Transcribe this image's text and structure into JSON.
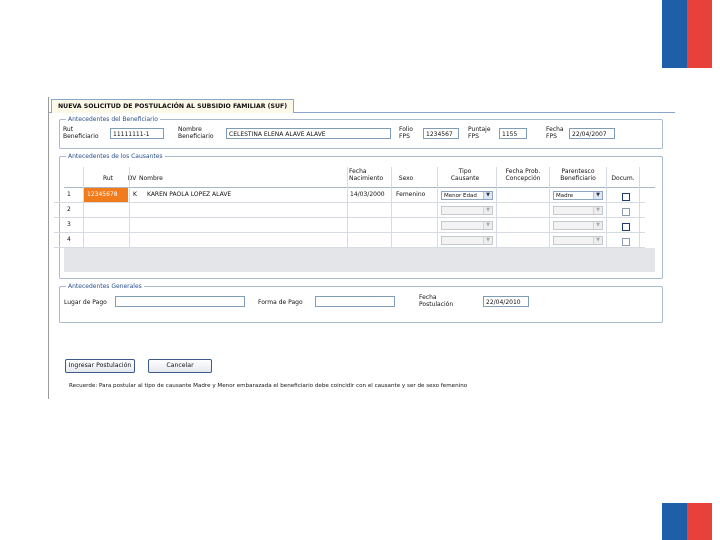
{
  "colors": {
    "flag_blue": "#1f5fa8",
    "flag_red": "#e8413c",
    "rut_highlight": "#f27b1c",
    "fieldset_border": "#a9bccf"
  },
  "tab": {
    "title": "NUEVA SOLICITUD DE POSTULACIÓN AL SUBSIDIO FAMILIAR (SUF)"
  },
  "beneficiario": {
    "legend": "Antecedentes del Beneficiario",
    "rut_label": "Rut Beneficiario",
    "rut_value": "11111111-1",
    "nombre_label": "Nombre Beneficiario",
    "nombre_value": "CELESTINA ELENA ALAVE ALAVE",
    "folio_label": "Folio FPS",
    "folio_value": "1234567",
    "puntaje_label": "Puntaje FPS",
    "puntaje_value": "1155",
    "fecha_label": "Fecha FPS",
    "fecha_value": "22/04/2007"
  },
  "causantes": {
    "legend": "Antecedentes de los Causantes",
    "headers": [
      "Rut",
      "DV",
      "Nombre",
      "Fecha Nacimiento",
      "Sexo",
      "Tipo Causante",
      "Fecha Prob. Concepción",
      "Parentesco Beneficiario",
      "Docum."
    ],
    "rows": [
      {
        "num": "1",
        "rut": "12345678",
        "dv": "K",
        "nombre": "KAREN PAOLA LOPEZ ALAVE",
        "fecha_nac": "14/03/2000",
        "sexo": "Femenino",
        "tipo": "Menor Edad",
        "parentesco": "Madre"
      },
      {
        "num": "2",
        "rut": "",
        "dv": "",
        "nombre": "",
        "fecha_nac": "",
        "sexo": "",
        "tipo": "",
        "parentesco": ""
      },
      {
        "num": "3",
        "rut": "",
        "dv": "",
        "nombre": "",
        "fecha_nac": "",
        "sexo": "",
        "tipo": "",
        "parentesco": ""
      },
      {
        "num": "4",
        "rut": "",
        "dv": "",
        "nombre": "",
        "fecha_nac": "",
        "sexo": "",
        "tipo": "",
        "parentesco": ""
      }
    ]
  },
  "generales": {
    "legend": "Antecedentes Generales",
    "lugar_label": "Lugar de Pago",
    "lugar_value": "",
    "forma_label": "Forma de Pago",
    "forma_value": "",
    "fecha_label": "Fecha Postulación",
    "fecha_value": "22/04/2010"
  },
  "buttons": {
    "ingresar": "Ingresar Postulación",
    "cancelar": "Cancelar"
  },
  "footer_note": "Recuerde: Para postular al tipo de causante Madre y Menor embarazada el beneficiario debe coincidir con el causante y ser de sexo femenino"
}
